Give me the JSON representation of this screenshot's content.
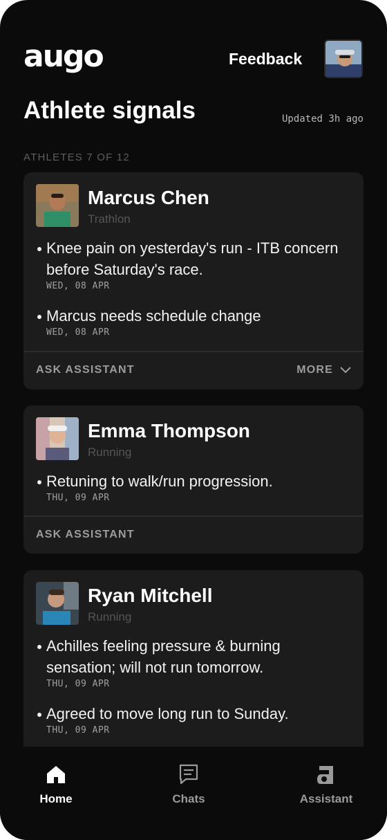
{
  "app": {
    "logo_text": "augo"
  },
  "header": {
    "feedback_label": "Feedback",
    "page_title": "Athlete signals",
    "updated_text": "Updated 3h ago",
    "section_label": "ATHLETES 7 OF 12"
  },
  "cards": [
    {
      "name": "Marcus Chen",
      "sport": "Trathlon",
      "signals": [
        {
          "text": "Knee pain on yesterday's run - ITB concern before Saturday's race.",
          "date": "WED, 08 APR"
        },
        {
          "text": "Marcus needs schedule change",
          "date": "WED, 08 APR"
        }
      ],
      "ask_label": "ASK ASSISTANT",
      "more_label": "MORE"
    },
    {
      "name": "Emma Thompson",
      "sport": "Running",
      "signals": [
        {
          "text": "Retuning to walk/run progression.",
          "date": "THU, 09 APR"
        }
      ],
      "ask_label": "ASK ASSISTANT"
    },
    {
      "name": "Ryan Mitchell",
      "sport": "Running",
      "signals": [
        {
          "text": "Achilles feeling pressure & burning sensation; will not run tomorrow.",
          "date": "THU, 09 APR"
        },
        {
          "text": "Agreed to move long run to Sunday.",
          "date": "THU, 09 APR"
        }
      ]
    }
  ],
  "nav": {
    "home_label": "Home",
    "chats_label": "Chats",
    "assistant_label": "Assistant"
  },
  "icons": {
    "home": "home-icon",
    "chats": "chat-bubble-icon",
    "assistant": "assistant-a-icon",
    "more": "chevron-down-icon"
  },
  "colors": {
    "background": "#0b0b0b",
    "card": "#1c1c1c",
    "text_primary": "#ffffff",
    "text_muted": "#9c9c9c"
  }
}
